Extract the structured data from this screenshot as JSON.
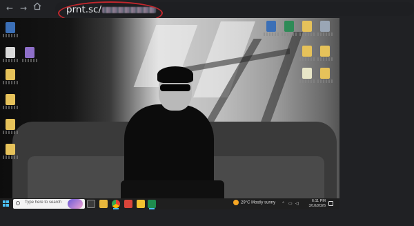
{
  "browser": {
    "back_icon": "arrow-left-icon",
    "forward_icon": "arrow-right-icon",
    "home_icon": "home-icon",
    "url": "prnt.sc/"
  },
  "taskbar": {
    "search_placeholder": "Type here to search",
    "weather_temp": "29°C",
    "weather_desc": "Mostly sunny",
    "time": "6:11 PM",
    "date": "3/10/2026"
  },
  "colors": {
    "annotation": "#c1272d",
    "accent": "#4cc2ff",
    "chrome_bg": "#202124"
  }
}
